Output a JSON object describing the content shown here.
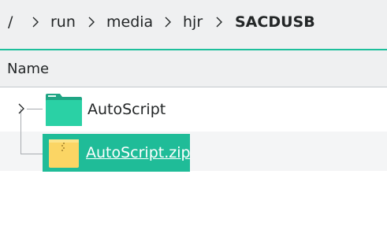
{
  "breadcrumb": {
    "root": "/",
    "items": [
      "run",
      "media",
      "hjr"
    ],
    "current": "SACDUSB"
  },
  "header": {
    "name_column": "Name"
  },
  "tree": {
    "items": [
      {
        "label": "AutoScript",
        "type": "folder",
        "icon": "folder-icon",
        "expanded": false
      },
      {
        "label": "AutoScript.zip",
        "type": "archive",
        "icon": "zip-archive-icon",
        "selected": true
      }
    ]
  },
  "colors": {
    "accent": "#1dbf9b",
    "selection": "#1fbc98",
    "folder": "#2ad1a5",
    "archive": "#fbd564"
  }
}
